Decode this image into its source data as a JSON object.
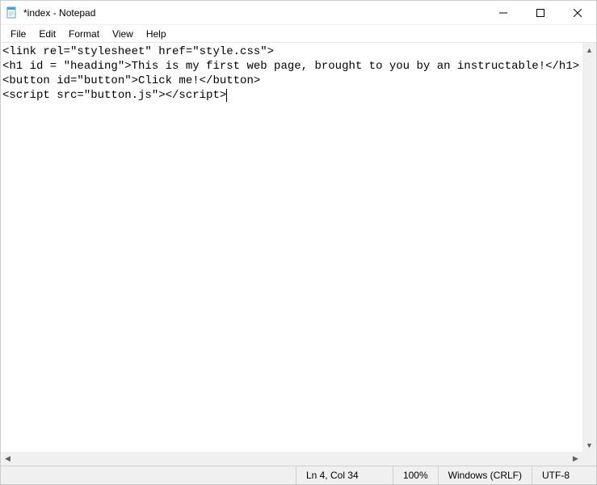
{
  "titlebar": {
    "title": "*index - Notepad"
  },
  "menubar": {
    "file": "File",
    "edit": "Edit",
    "format": "Format",
    "view": "View",
    "help": "Help"
  },
  "editor": {
    "lines": [
      "<link rel=\"stylesheet\" href=\"style.css\">",
      "<h1 id = \"heading\">This is my first web page, brought to you by an instructable!</h1>",
      "<button id=\"button\">Click me!</button>",
      "<script src=\"button.js\"></script>"
    ]
  },
  "statusbar": {
    "position": "Ln 4, Col 34",
    "zoom": "100%",
    "line_ending": "Windows (CRLF)",
    "encoding": "UTF-8"
  }
}
